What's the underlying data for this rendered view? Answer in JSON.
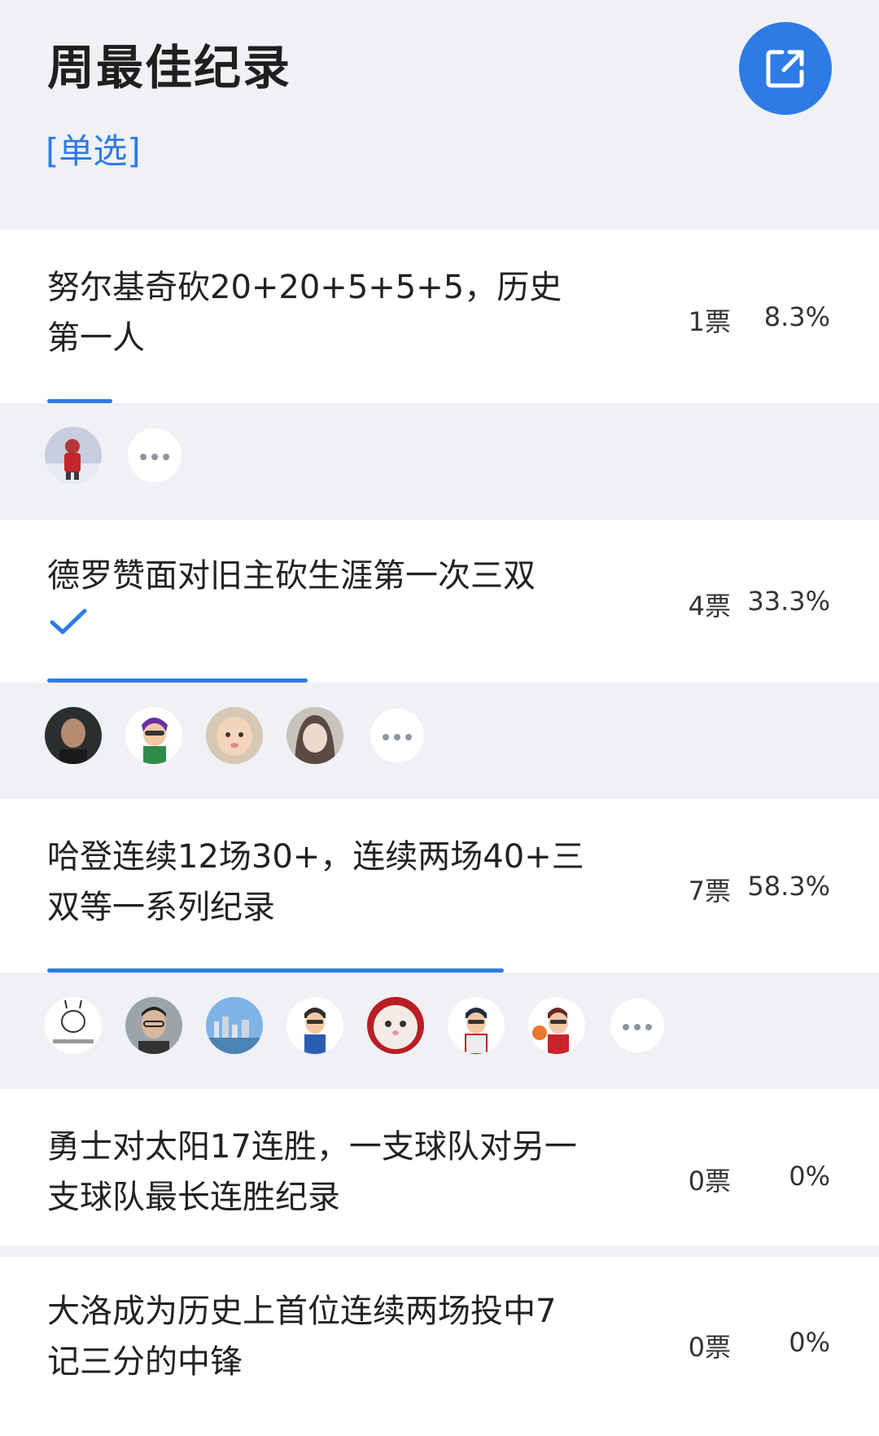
{
  "header": {
    "title": "周最佳纪录",
    "subtitle": "[单选]",
    "share_icon": "external-link-icon"
  },
  "colors": {
    "accent": "#2e7be6",
    "background": "#eff1f4"
  },
  "options": [
    {
      "text": "努尔基奇砍20+20+5+5+5，历史第一人",
      "votes": "1票",
      "percent": "8.3%",
      "fraction": 0.083,
      "selected": false
    },
    {
      "text": "德罗赞面对旧主砍生涯第一次三双",
      "votes": "4票",
      "percent": "33.3%",
      "fraction": 0.333,
      "selected": true
    },
    {
      "text": "哈登连续12场30+，连续两场40+三双等一系列纪录",
      "votes": "7票",
      "percent": "58.3%",
      "fraction": 0.583,
      "selected": false
    },
    {
      "text": "勇士对太阳17连胜，一支球队对另一支球队最长连胜纪录",
      "votes": "0票",
      "percent": "0%",
      "fraction": 0,
      "selected": false
    },
    {
      "text": "大洛成为历史上首位连续两场投中7记三分的中锋",
      "votes": "0票",
      "percent": "0%",
      "fraction": 0,
      "selected": false
    }
  ],
  "more_icon": "more-dots-icon",
  "check_icon": "checkmark-icon"
}
